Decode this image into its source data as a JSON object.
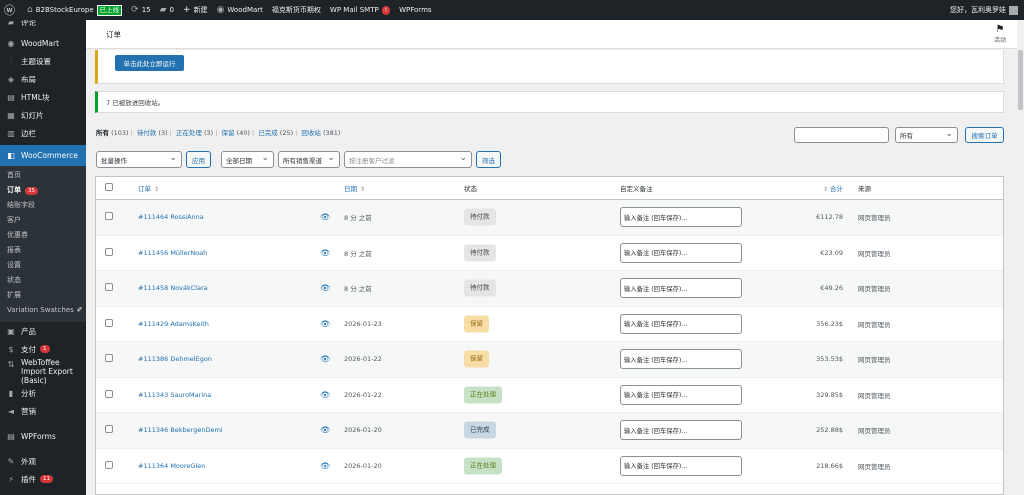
{
  "adminbar": {
    "site_name": "B2BStockEurope",
    "live_badge": "已上线",
    "updates_count": "15",
    "comments_count": "0",
    "new_label": "新建",
    "woodmart_label": "WoodMart",
    "plugin_label": "福克斯货币期权",
    "smtp_label": "WP Mail SMTP",
    "smtp_badge": "!",
    "wpforms_label": "WPForms",
    "howdy": "您好，瓦利奥罗娃"
  },
  "sidebar": {
    "top_items": [
      {
        "label": "评论"
      },
      {
        "label": "WoodMart"
      },
      {
        "label": "主题设置"
      },
      {
        "label": "布局"
      },
      {
        "label": "HTML块"
      },
      {
        "label": "幻灯片"
      },
      {
        "label": "边栏"
      }
    ],
    "woocommerce": "WooCommerce",
    "submenu": [
      {
        "label": "首页"
      },
      {
        "label": "订单",
        "badge": "35"
      },
      {
        "label": "结账字段"
      },
      {
        "label": "客户"
      },
      {
        "label": "优惠券"
      },
      {
        "label": "报表"
      },
      {
        "label": "设置"
      },
      {
        "label": "状态"
      },
      {
        "label": "扩展"
      },
      {
        "label": "Variation Swatches"
      }
    ],
    "bottom_items": [
      {
        "label": "产品"
      },
      {
        "label": "支付",
        "badge": "1"
      },
      {
        "label": "WebToffee Import Export (Basic)"
      },
      {
        "label": "分析"
      },
      {
        "label": "营销"
      },
      {
        "label": "WPForms"
      },
      {
        "label": "外观"
      },
      {
        "label": "插件",
        "badge": "11"
      }
    ]
  },
  "header": {
    "title": "订单",
    "activity": "活动"
  },
  "notices": {
    "run_button": "单击此处立即运行",
    "trash_message": "7 已被放进回收站。"
  },
  "filters": {
    "status_links": [
      {
        "label": "所有",
        "count": "(103)"
      },
      {
        "label": "待付款",
        "count": "(3)"
      },
      {
        "label": "正在处理",
        "count": "(3)"
      },
      {
        "label": "保留",
        "count": "(40)"
      },
      {
        "label": "已完成",
        "count": "(25)"
      },
      {
        "label": "回收站",
        "count": "(381)"
      }
    ],
    "search_value": "",
    "search_scope": "所有",
    "search_button": "搜索订单",
    "bulk_action": "批量操作",
    "apply_button": "应用",
    "date_filter": "全部日期",
    "channel_filter": "所有销售渠道",
    "customer_placeholder": "按注册客户过滤",
    "filter_button": "筛选"
  },
  "table": {
    "columns": {
      "order": "订单",
      "date": "日期",
      "status": "状态",
      "note": "自定义备注",
      "total": "合计",
      "source": "来源"
    },
    "note_placeholder": "输入备注 (回车保存)...",
    "rows": [
      {
        "order": "#111464 RossiAnna",
        "date": "8 分 之前",
        "status": "待付款",
        "status_key": "pending",
        "total": "€112.78",
        "source": "网页管理员"
      },
      {
        "order": "#111456 MüllerNoah",
        "date": "8 分 之前",
        "status": "待付款",
        "status_key": "pending",
        "total": "€23.09",
        "source": "网页管理员"
      },
      {
        "order": "#111458 NovákClara",
        "date": "8 分 之前",
        "status": "待付款",
        "status_key": "pending",
        "total": "€49.26",
        "source": "网页管理员"
      },
      {
        "order": "#111429 AdamsKeith",
        "date": "2026-01-23",
        "status": "保留",
        "status_key": "hold",
        "total": "356.23$",
        "source": "网页管理员"
      },
      {
        "order": "#111386 DehmelEgon",
        "date": "2026-01-22",
        "status": "保留",
        "status_key": "hold",
        "total": "353.53$",
        "source": "网页管理员"
      },
      {
        "order": "#111343 SauroMarina",
        "date": "2026-01-22",
        "status": "正在处理",
        "status_key": "processing",
        "total": "329.85$",
        "source": "网页管理员"
      },
      {
        "order": "#111346 BekbergenDemi",
        "date": "2026-01-20",
        "status": "已完成",
        "status_key": "completed",
        "total": "252.88$",
        "source": "网页管理员"
      },
      {
        "order": "#111364 MooreGlen",
        "date": "2026-01-20",
        "status": "正在处理",
        "status_key": "processing",
        "total": "218.66$",
        "source": "网页管理员"
      }
    ]
  }
}
